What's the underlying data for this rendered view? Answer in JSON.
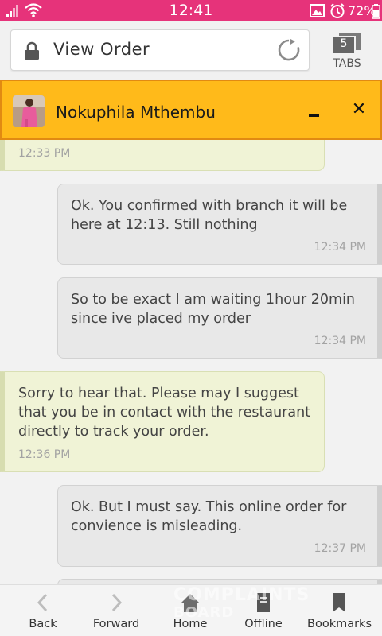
{
  "status_bar": {
    "time": "12:41",
    "battery": "72%",
    "accent_color": "#e6337a"
  },
  "browser": {
    "url_title": "View Order",
    "tabs_count": "5",
    "tabs_label": "TABS"
  },
  "chat": {
    "contact_name": "Nokuphila Mthembu",
    "header_color": "#ffba1a",
    "messages": [
      {
        "from": "agent",
        "text": "",
        "time": "12:33 PM"
      },
      {
        "from": "user",
        "text": "Ok. You confirmed with branch it will be here at 12:13. Still nothing",
        "time": "12:34 PM"
      },
      {
        "from": "user",
        "text": "So to be exact I am waiting 1hour 20min since ive placed my order",
        "time": "12:34 PM"
      },
      {
        "from": "agent",
        "text": "Sorry to hear that. Please may I suggest that you be in contact with the restaurant directly to track your order.",
        "time": "12:36 PM"
      },
      {
        "from": "user",
        "text": "Ok. But I must say. This online order for convience is misleading.",
        "time": "12:37 PM"
      }
    ]
  },
  "bottom_nav": {
    "items": [
      {
        "label": "Back",
        "icon": "chevron-left-icon"
      },
      {
        "label": "Forward",
        "icon": "chevron-right-icon"
      },
      {
        "label": "Home",
        "icon": "home-icon"
      },
      {
        "label": "Offline",
        "icon": "offline-icon"
      },
      {
        "label": "Bookmarks",
        "icon": "bookmark-icon"
      }
    ]
  },
  "watermark": {
    "line1": "COMPLAINTS",
    "line2": "BOARD"
  }
}
